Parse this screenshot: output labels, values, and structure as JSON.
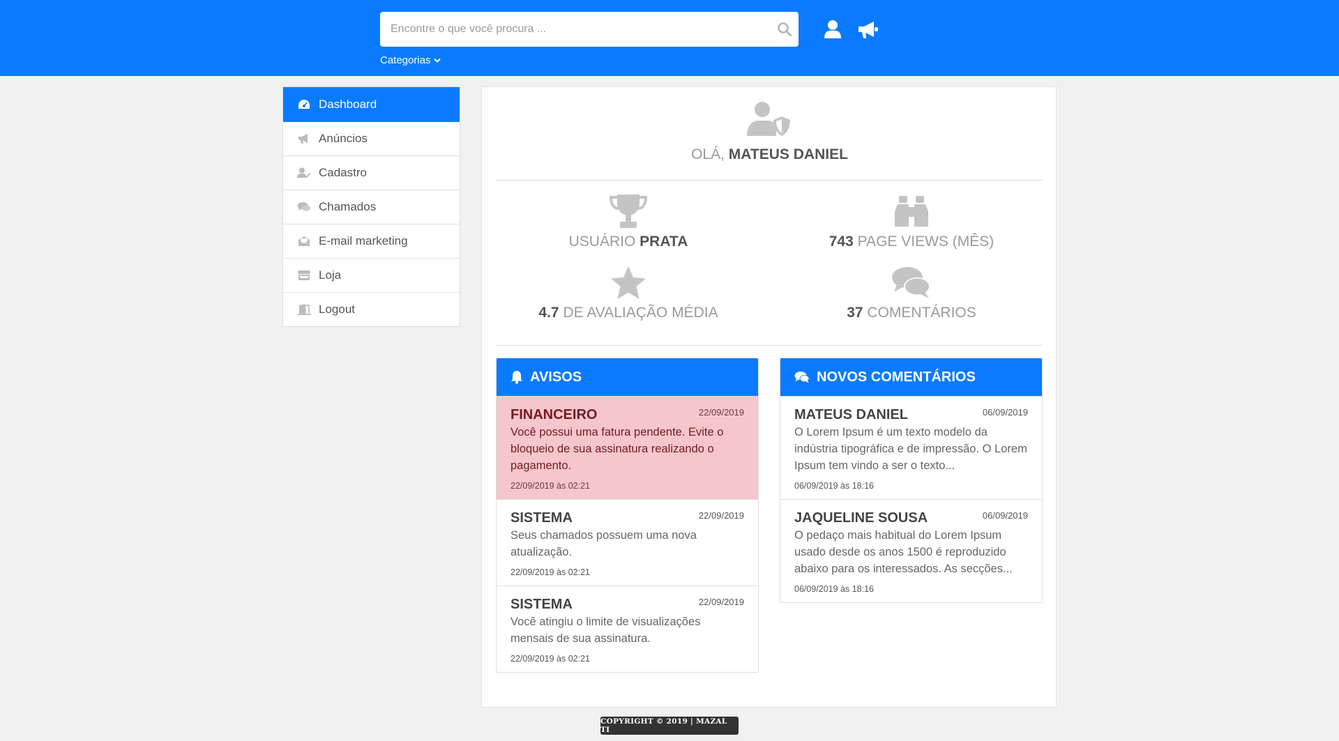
{
  "header": {
    "search_placeholder": "Encontre o que você procura ...",
    "categories_label": "Categorias",
    "brand_color": "#0a7bff"
  },
  "sidebar": {
    "items": [
      {
        "label": "Dashboard",
        "icon": "dashboard-icon",
        "active": true
      },
      {
        "label": "Anúncios",
        "icon": "megaphone-icon"
      },
      {
        "label": "Cadastro",
        "icon": "user-edit-icon"
      },
      {
        "label": "Chamados",
        "icon": "comments-icon"
      },
      {
        "label": "E-mail marketing",
        "icon": "envelope-open-icon"
      },
      {
        "label": "Loja",
        "icon": "store-icon"
      },
      {
        "label": "Logout",
        "icon": "door-exit-icon"
      }
    ]
  },
  "greeting": {
    "prefix": "Olá,",
    "name": "MATEUS DANIEL"
  },
  "stats": {
    "level": {
      "prefix": "USUÁRIO",
      "value": "PRATA"
    },
    "views": {
      "value": "743",
      "suffix": "PAGE VIEWS (MÊS)"
    },
    "rating": {
      "value": "4.7",
      "suffix": "DE AVALIAÇÃO MÉDIA"
    },
    "comments": {
      "value": "37",
      "suffix": "COMENTÁRIOS"
    }
  },
  "avisos": {
    "title": "AVISOS",
    "items": [
      {
        "title": "FINANCEIRO",
        "date": "22/09/2019",
        "body": "Você possui uma fatura pendente. Evite o bloqueio de sua assinatura realizando o pagamento.",
        "footer": "22/09/2019 às 02:21"
      },
      {
        "title": "SISTEMA",
        "date": "22/09/2019",
        "body": "Seus chamados possuem uma nova atualização.",
        "footer": "22/09/2019 às 02:21"
      },
      {
        "title": "SISTEMA",
        "date": "22/09/2019",
        "body": "Você atingiu o limite de visualizações mensais de sua assinatura.",
        "footer": "22/09/2019 às 02:21"
      }
    ]
  },
  "comentarios": {
    "title": "NOVOS COMENTÁRIOS",
    "items": [
      {
        "title": "MATEUS DANIEL",
        "date": "06/09/2019",
        "body": "O Lorem Ipsum é um texto modelo da indústria tipográfica e de impressão. O Lorem Ipsum tem vindo a ser o texto...",
        "footer": "06/09/2019 às 18:16"
      },
      {
        "title": "JAQUELINE SOUSA",
        "date": "06/09/2019",
        "body": "O pedaço mais habitual do Lorem Ipsum usado desde os anos 1500 é reproduzido abaixo para os interessados. As secções...",
        "footer": "06/09/2019 às 18:16"
      }
    ]
  },
  "footer": {
    "copyright": "COPYRIGHT © 2019 | MAZAL TI"
  }
}
